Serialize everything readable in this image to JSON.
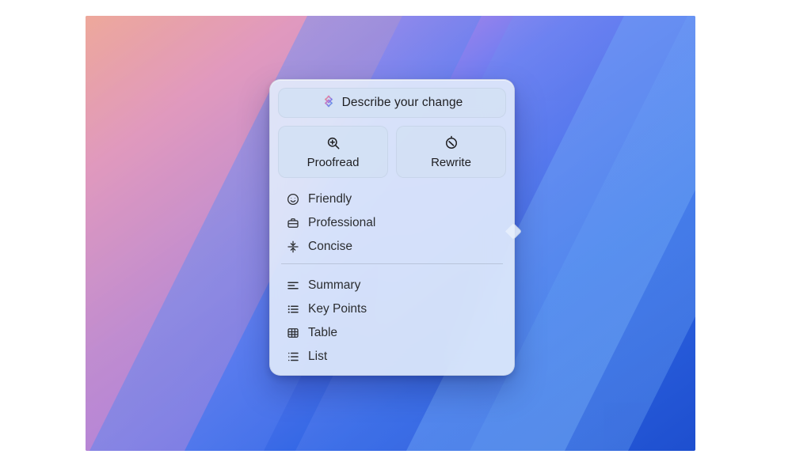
{
  "popover": {
    "describe_label": "Describe your change",
    "tiles": {
      "proofread": "Proofread",
      "rewrite": "Rewrite"
    },
    "tone_items": {
      "friendly": "Friendly",
      "professional": "Professional",
      "concise": "Concise"
    },
    "format_items": {
      "summary": "Summary",
      "key_points": "Key Points",
      "table": "Table",
      "list": "List"
    }
  }
}
